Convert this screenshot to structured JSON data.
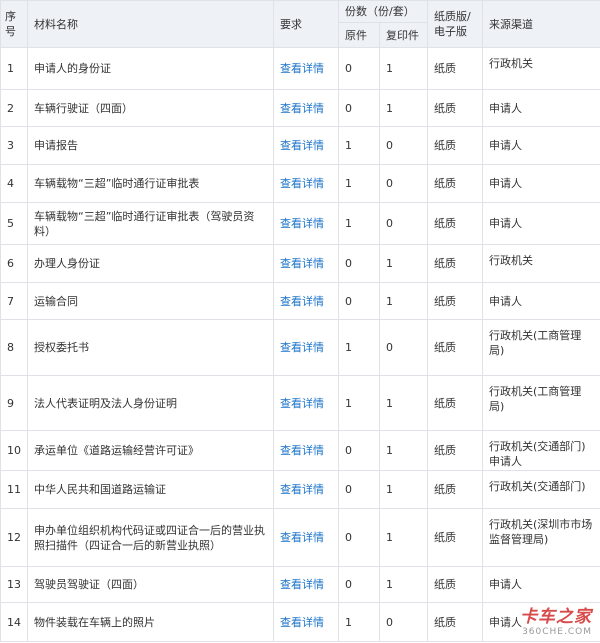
{
  "header": {
    "no": "序号",
    "name": "材料名称",
    "req": "要求",
    "copies": "份数（份/套）",
    "original": "原件",
    "copy": "复印件",
    "format": "纸质版/电子版",
    "source": "来源渠道"
  },
  "detail_link": "查看详情",
  "rows": [
    {
      "no": "1",
      "name": "申请人的身份证",
      "original": "0",
      "copy": "1",
      "format": "纸质",
      "source": "行政机关"
    },
    {
      "no": "2",
      "name": "车辆行驶证（四面）",
      "original": "0",
      "copy": "1",
      "format": "纸质",
      "source": "申请人"
    },
    {
      "no": "3",
      "name": "申请报告",
      "original": "1",
      "copy": "0",
      "format": "纸质",
      "source": "申请人"
    },
    {
      "no": "4",
      "name": "车辆载物“三超”临时通行证审批表",
      "original": "1",
      "copy": "0",
      "format": "纸质",
      "source": "申请人"
    },
    {
      "no": "5",
      "name": "车辆载物“三超”临时通行证审批表（驾驶员资料）",
      "original": "1",
      "copy": "0",
      "format": "纸质",
      "source": "申请人"
    },
    {
      "no": "6",
      "name": "办理人身份证",
      "original": "0",
      "copy": "1",
      "format": "纸质",
      "source": "行政机关"
    },
    {
      "no": "7",
      "name": "运输合同",
      "original": "0",
      "copy": "1",
      "format": "纸质",
      "source": "申请人"
    },
    {
      "no": "8",
      "name": "授权委托书",
      "original": "1",
      "copy": "0",
      "format": "纸质",
      "source": "行政机关(工商管理局)"
    },
    {
      "no": "9",
      "name": "法人代表证明及法人身份证明",
      "original": "1",
      "copy": "1",
      "format": "纸质",
      "source": "行政机关(工商管理局)"
    },
    {
      "no": "10",
      "name": "承运单位《道路运输经营许可证》",
      "original": "0",
      "copy": "1",
      "format": "纸质",
      "source": "行政机关(交通部门) 申请人"
    },
    {
      "no": "11",
      "name": "中华人民共和国道路运输证",
      "original": "0",
      "copy": "1",
      "format": "纸质",
      "source": "行政机关(交通部门)"
    },
    {
      "no": "12",
      "name": "申办单位组织机构代码证或四证合一后的营业执照扫描件（四证合一后的新营业执照）",
      "original": "0",
      "copy": "1",
      "format": "纸质",
      "source": "行政机关(深圳市市场监督管理局)"
    },
    {
      "no": "13",
      "name": "驾驶员驾驶证（四面）",
      "original": "0",
      "copy": "1",
      "format": "纸质",
      "source": "申请人"
    },
    {
      "no": "14",
      "name": "物件装载在车辆上的照片",
      "original": "1",
      "copy": "0",
      "format": "纸质",
      "source": "申请人"
    }
  ],
  "watermark": {
    "main": "卡车之家",
    "sub": "360CHE.COM"
  }
}
